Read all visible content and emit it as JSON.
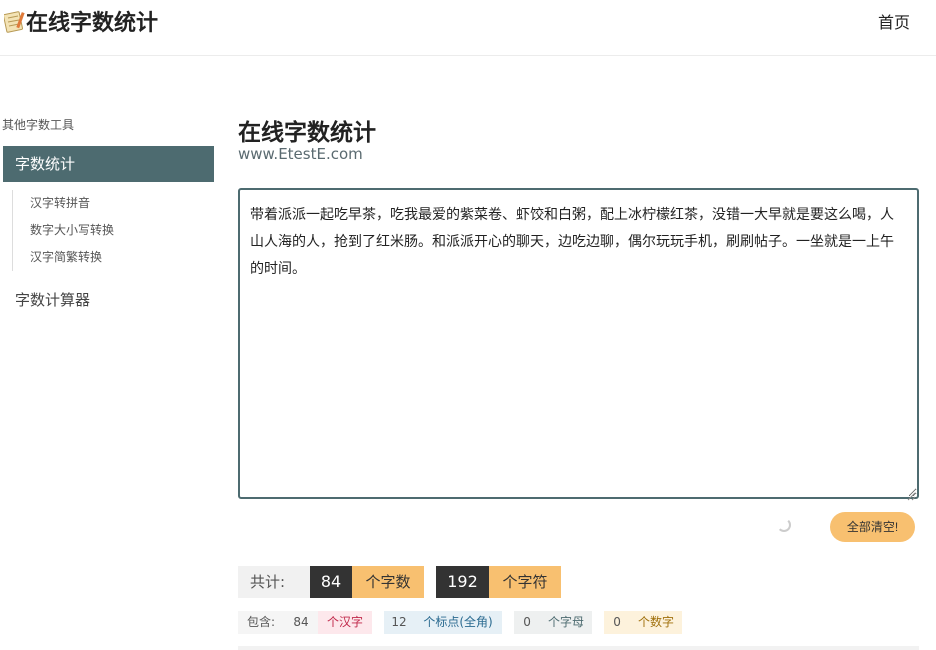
{
  "header": {
    "logo_text": "在线字数统计",
    "nav_home": "首页"
  },
  "sidebar": {
    "title": "其他字数工具",
    "active_item": "字数统计",
    "sub_items": [
      {
        "label": "汉字转拼音"
      },
      {
        "label": "数字大小写转换"
      },
      {
        "label": "汉字简繁转换"
      }
    ],
    "calc_item": "字数计算器"
  },
  "main": {
    "title": "在线字数统计",
    "subtitle": "www.EtestE.com",
    "editor_text": "带着派派一起吃早茶，吃我最爱的紫菜卷、虾饺和白粥，配上冰柠檬红茶，没错一大早就是要这么喝，人山人海的人，抢到了红米肠。和派派开心的聊天，边吃边聊，偶尔玩玩手机，刷刷帖子。一坐就是一上午的时间。",
    "clear_button": "全部清空!"
  },
  "totals": {
    "label": "共计:",
    "word_count": "84",
    "word_unit": "个字数",
    "char_count": "192",
    "char_unit": "个字符"
  },
  "includes": {
    "label": "包含:",
    "hanzi_count": "84",
    "hanzi_unit": "个汉字",
    "punct_count": "12",
    "punct_unit": "个标点(全角)",
    "letter_count": "0",
    "letter_unit": "个字母",
    "digit_count": "0",
    "digit_unit": "个数字"
  },
  "colors": {
    "accent": "#4d6b70",
    "highlight": "#f8c070",
    "dark": "#333333"
  }
}
